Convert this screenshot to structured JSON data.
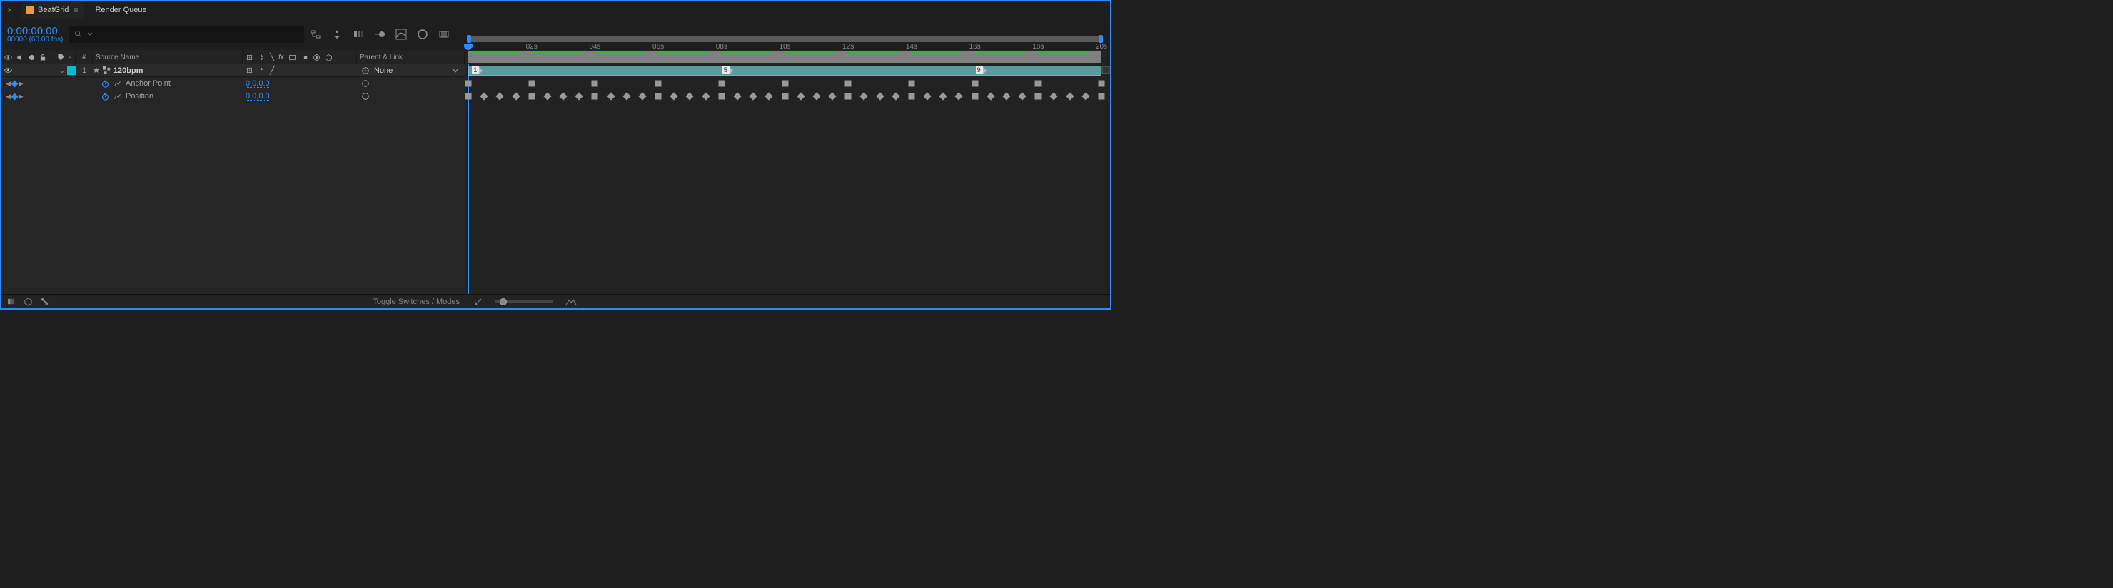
{
  "tabs": {
    "close_x": "×",
    "active_name": "BeatGrid",
    "menu_glyph": "≡",
    "render_queue": "Render Queue"
  },
  "header": {
    "timecode": "0:00:00:00",
    "timecode_sub": "00000 (60.00 fps)",
    "search_placeholder": ""
  },
  "columns": {
    "index_header": "#",
    "source_name": "Source Name",
    "parent_link": "Parent & Link"
  },
  "ruler_ticks": [
    "02s",
    "04s",
    "06s",
    "08s",
    "10s",
    "12s",
    "14s",
    "16s",
    "18s",
    "20s"
  ],
  "layer": {
    "index": "1",
    "name": "120bpm",
    "parent_value": "None",
    "markers": [
      {
        "label": "1",
        "pct": 0.5
      },
      {
        "label": "5",
        "pct": 40.0
      },
      {
        "label": "9",
        "pct": 80.0
      }
    ]
  },
  "props": {
    "anchor": {
      "label": "Anchor Point",
      "value": "0.0,0.0"
    },
    "position": {
      "label": "Position",
      "value": "0.0,0.0"
    }
  },
  "green_segments": [
    [
      0.5,
      8.5
    ],
    [
      10,
      18
    ],
    [
      20,
      28
    ],
    [
      30,
      38
    ],
    [
      40,
      48
    ],
    [
      50,
      58
    ],
    [
      60,
      68
    ],
    [
      70,
      78
    ],
    [
      80,
      88
    ],
    [
      90,
      98
    ]
  ],
  "anchor_keys_pct": [
    0,
    10,
    20,
    30,
    40,
    50,
    60,
    70,
    80,
    90,
    100
  ],
  "pos_keys_pct": [
    0,
    2.5,
    5,
    7.5,
    10,
    12.5,
    15,
    17.5,
    20,
    22.5,
    25,
    27.5,
    30,
    32.5,
    35,
    37.5,
    40,
    42.5,
    45,
    47.5,
    50,
    52.5,
    55,
    57.5,
    60,
    62.5,
    65,
    67.5,
    70,
    72.5,
    75,
    77.5,
    80,
    82.5,
    85,
    87.5,
    90,
    92.5,
    95,
    97.5,
    100
  ],
  "footer": {
    "toggle": "Toggle Switches / Modes"
  }
}
